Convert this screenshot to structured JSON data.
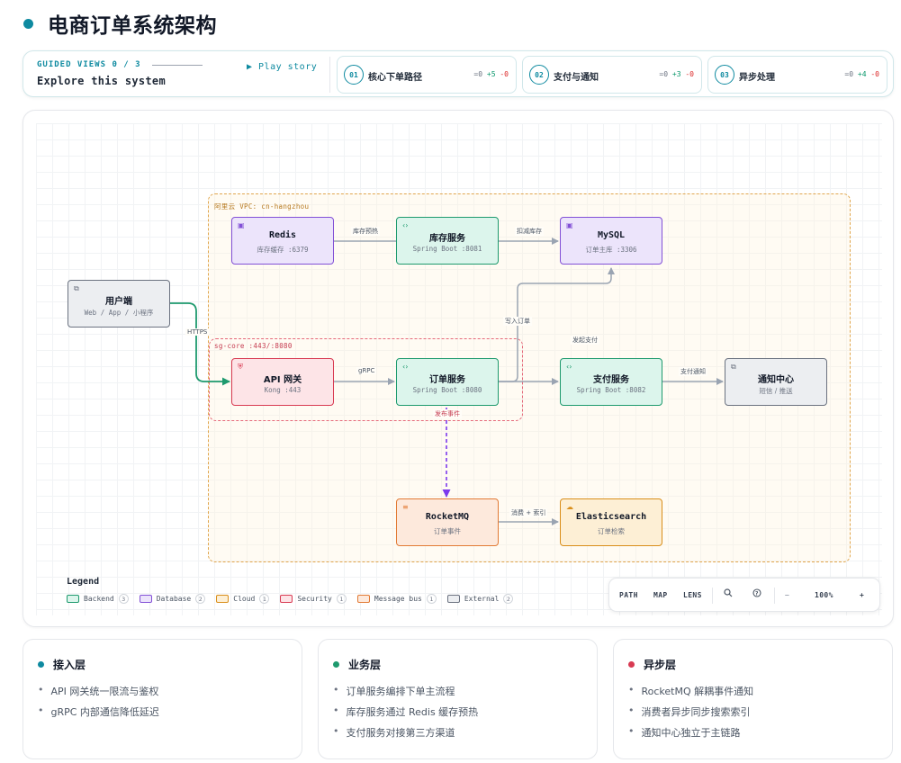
{
  "page": {
    "title": "电商订单系统架构"
  },
  "guided": {
    "kicker": "GUIDED VIEWS 0 / 3",
    "subtitle": "Explore this system",
    "play": "▶ Play story",
    "steps": [
      {
        "num": "01",
        "label": "核心下单路径",
        "eq": "=0",
        "add": "+5",
        "rem": "-0"
      },
      {
        "num": "02",
        "label": "支付与通知",
        "eq": "=0",
        "add": "+3",
        "rem": "-0"
      },
      {
        "num": "03",
        "label": "异步处理",
        "eq": "=0",
        "add": "+4",
        "rem": "-0"
      }
    ]
  },
  "diagram": {
    "groups": {
      "vpc": "阿里云 VPC: cn-hangzhou",
      "sg": "sg-core :443/:8080"
    },
    "nodes": {
      "redis": {
        "title": "Redis",
        "sub": "库存缓存 :6379",
        "icon": "database-icon"
      },
      "inventory": {
        "title": "库存服务",
        "sub": "Spring Boot :8081",
        "icon": "code-icon"
      },
      "mysql": {
        "title": "MySQL",
        "sub": "订单主库 :3306",
        "icon": "database-icon"
      },
      "client": {
        "title": "用户端",
        "sub": "Web / App / 小程序",
        "icon": "window-icon"
      },
      "gateway": {
        "title": "API 网关",
        "sub": "Kong :443",
        "icon": "shield-icon"
      },
      "order": {
        "title": "订单服务",
        "sub": "Spring Boot :8080",
        "icon": "code-icon"
      },
      "payment": {
        "title": "支付服务",
        "sub": "Spring Boot :8082",
        "icon": "code-icon"
      },
      "notify": {
        "title": "通知中心",
        "sub": "短信 / 推送",
        "icon": "window-icon"
      },
      "mq": {
        "title": "RocketMQ",
        "sub": "订单事件",
        "icon": "queue-icon"
      },
      "es": {
        "title": "Elasticsearch",
        "sub": "订单检索",
        "icon": "cloud-icon"
      }
    },
    "edges": {
      "inv_redis": "库存预热",
      "inv_mysql": "扣减库存",
      "client_gw": "HTTPS",
      "gw_order": "gRPC",
      "order_mysql": "写入订单",
      "order_pay": "发起支付",
      "pay_notify": "支付通知",
      "order_mq": "发布事件",
      "mq_es": "消费 + 索引"
    },
    "colors": {
      "backend": "#1e9a6e",
      "database": "#8250d6",
      "cloud": "#d98e1a",
      "security": "#d83a52",
      "message_bus": "#e27a35",
      "external": "#6b7280",
      "accent": "#0e8aa0"
    }
  },
  "legend": {
    "title": "Legend",
    "items": [
      {
        "label": "Backend",
        "count": "3"
      },
      {
        "label": "Database",
        "count": "2"
      },
      {
        "label": "Cloud",
        "count": "1"
      },
      {
        "label": "Security",
        "count": "1"
      },
      {
        "label": "Message bus",
        "count": "1"
      },
      {
        "label": "External",
        "count": "2"
      }
    ]
  },
  "toolbar": {
    "path": "PATH",
    "map": "MAP",
    "lens": "LENS",
    "search_icon": "search-icon",
    "help_icon": "help-icon",
    "minus": "−",
    "zoom": "100%",
    "plus": "+"
  },
  "cards": [
    {
      "title": "接入层",
      "color": "#0e8aa0",
      "items": [
        "API 网关统一限流与鉴权",
        "gRPC 内部通信降低延迟"
      ]
    },
    {
      "title": "业务层",
      "color": "#1e9a6e",
      "items": [
        "订单服务编排下单主流程",
        "库存服务通过 Redis 缓存预热",
        "支付服务对接第三方渠道"
      ]
    },
    {
      "title": "异步层",
      "color": "#d83a52",
      "items": [
        "RocketMQ 解耦事件通知",
        "消费者异步同步搜索索引",
        "通知中心独立于主链路"
      ]
    }
  ]
}
